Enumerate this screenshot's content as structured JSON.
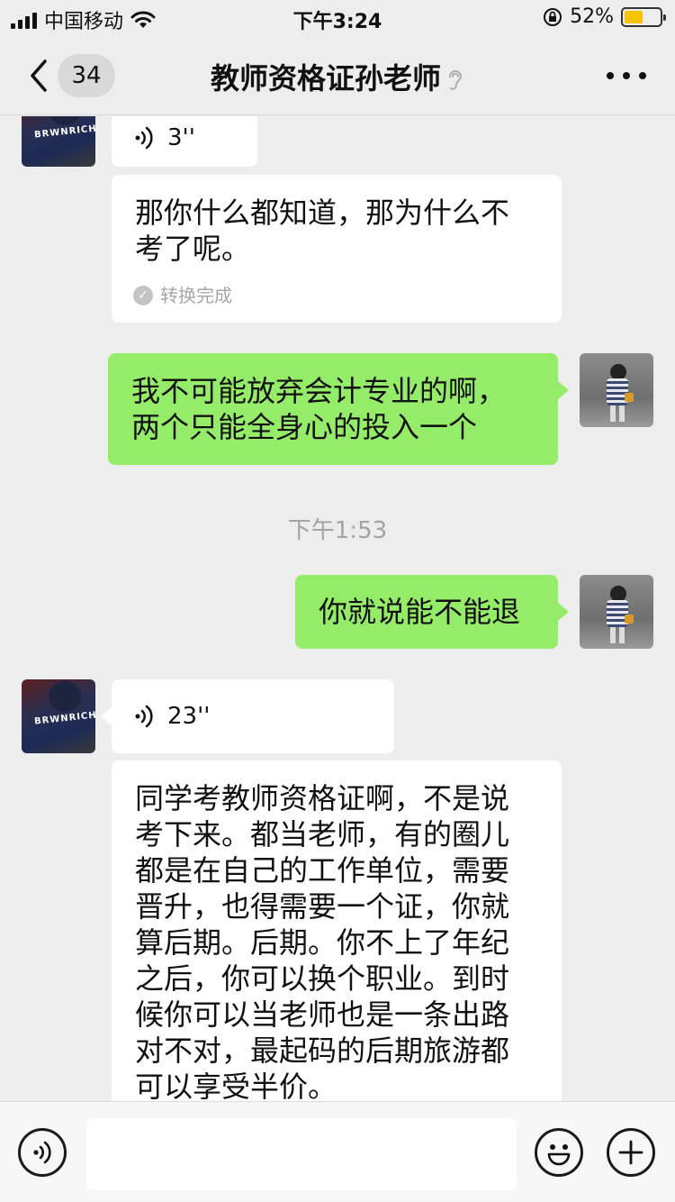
{
  "status_bar": {
    "carrier": "中国移动",
    "time": "下午3:24",
    "battery_percent": "52%",
    "battery_level": 0.52,
    "icons": [
      "signal-icon",
      "wifi-icon",
      "orientation-lock-icon",
      "battery-icon"
    ]
  },
  "nav": {
    "unread_count": "34",
    "title": "教师资格证孙老师",
    "icons": [
      "back-chevron-icon",
      "ear-icon",
      "more-icon"
    ]
  },
  "messages": [
    {
      "type": "voice",
      "side": "left",
      "duration": "3''"
    },
    {
      "type": "voice_text",
      "side": "left",
      "text_lines": [
        "那你什么都知道，那为什么不",
        "考了呢。"
      ],
      "status": "转换完成"
    },
    {
      "type": "text",
      "side": "right",
      "text_lines": [
        "我不可能放弃会计专业的啊，",
        "两个只能全身心的投入一个"
      ]
    },
    {
      "type": "timestamp",
      "text": "下午1:53"
    },
    {
      "type": "text",
      "side": "right",
      "text_lines": [
        "你就说能不能退"
      ]
    },
    {
      "type": "voice",
      "side": "left",
      "duration": "23''"
    },
    {
      "type": "voice_text",
      "side": "left",
      "text_lines": [
        "同学考教师资格证啊，不是说",
        "考下来。都当老师，有的圈儿",
        "都是在自己的工作单位，需要",
        "晋升，也得需要一个证，你就",
        "算后期。后期。你不上了年纪",
        "之后，你可以换个职业。到时",
        "候你可以当老师也是一条出路",
        "对不对，最起码的后期旅游都",
        "可以享受半价。"
      ]
    }
  ],
  "avatars": {
    "left_brand_text": "BRWNRICH"
  },
  "input_bar": {
    "placeholder": "",
    "icons": [
      "voice-mode-icon",
      "emoji-icon",
      "plus-icon"
    ]
  },
  "colors": {
    "background": "#ededed",
    "my_bubble": "#95ec69",
    "their_bubble": "#ffffff",
    "battery_fill": "#f5c400"
  }
}
